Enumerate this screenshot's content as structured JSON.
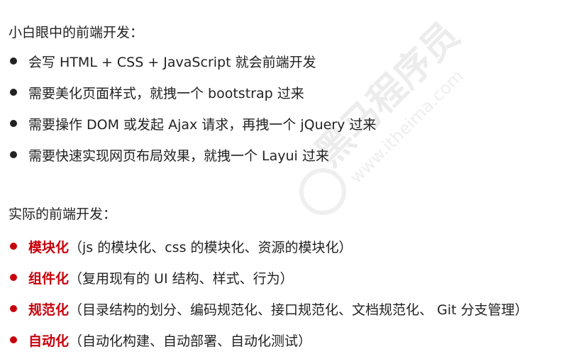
{
  "section1": {
    "heading": "小白眼中的前端开发：",
    "items": [
      "会写 HTML + CSS + JavaScript 就会前端开发",
      "需要美化页面样式，就拽一个 bootstrap 过来",
      "需要操作 DOM 或发起 Ajax 请求，再拽一个 jQuery 过来",
      "需要快速实现网页布局效果，就拽一个 Layui 过来"
    ]
  },
  "section2": {
    "heading": "实际的前端开发：",
    "items": [
      {
        "keyword": "模块化",
        "detail": "（js 的模块化、css 的模块化、资源的模块化）"
      },
      {
        "keyword": "组件化",
        "detail": "（复用现有的 UI 结构、样式、行为）"
      },
      {
        "keyword": "规范化",
        "detail": "（目录结构的划分、编码规范化、接口规范化、文档规范化、 Git 分支管理）"
      },
      {
        "keyword": "自动化",
        "detail": "（自动化构建、自动部署、自动化测试）"
      }
    ]
  },
  "watermark": {
    "brand": "黑马程序员",
    "url": "www.itheima.com"
  },
  "colors": {
    "accent": "#c7000b",
    "text": "#222222",
    "watermark": "#ebebeb"
  }
}
